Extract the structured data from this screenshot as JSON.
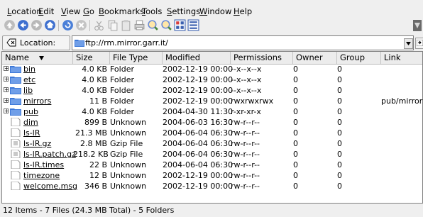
{
  "menu": [
    {
      "label": "Location",
      "u": "L",
      "rest": "ocation"
    },
    {
      "label": "Edit",
      "u": "E",
      "rest": "dit"
    },
    {
      "label": "View",
      "u": "V",
      "rest": "iew"
    },
    {
      "label": "Go",
      "u": "G",
      "rest": "o"
    },
    {
      "label": "Bookmarks",
      "u": "B",
      "rest": "ookmarks"
    },
    {
      "label": "Tools",
      "u": "T",
      "rest": "ools"
    },
    {
      "label": "Settings",
      "u": "S",
      "rest": "ettings"
    },
    {
      "label": "Window",
      "u": "W",
      "rest": "indow"
    },
    {
      "label": "Help",
      "u": "H",
      "rest": "elp"
    }
  ],
  "location": {
    "button_label": "Location:",
    "url": "ftp://rm.mirror.garr.it/"
  },
  "columns": [
    "Name",
    "Size",
    "File Type",
    "Modified",
    "Permissions",
    "Owner",
    "Group",
    "Link"
  ],
  "rows": [
    {
      "name": "bin",
      "size": "4.0 KB",
      "type": "Folder",
      "modified": "2002-12-19 00:00",
      "perm": "--x--x--x",
      "owner": "0",
      "group": "0",
      "link": "",
      "kind": "folder"
    },
    {
      "name": "etc",
      "size": "4.0 KB",
      "type": "Folder",
      "modified": "2002-12-19 00:00",
      "perm": "--x--x--x",
      "owner": "0",
      "group": "0",
      "link": "",
      "kind": "folder"
    },
    {
      "name": "lib",
      "size": "4.0 KB",
      "type": "Folder",
      "modified": "2002-12-19 00:00",
      "perm": "--x--x--x",
      "owner": "0",
      "group": "0",
      "link": "",
      "kind": "folder"
    },
    {
      "name": "mirrors",
      "size": "11 B",
      "type": "Folder",
      "modified": "2002-12-19 00:00",
      "perm": "rwxrwxrwx",
      "owner": "0",
      "group": "0",
      "link": "pub/mirrors",
      "kind": "folder"
    },
    {
      "name": "pub",
      "size": "4.0 KB",
      "type": "Folder",
      "modified": "2004-04-30 11:30",
      "perm": "r-xr-xr-x",
      "owner": "0",
      "group": "0",
      "link": "",
      "kind": "folder"
    },
    {
      "name": "dim",
      "size": "899 B",
      "type": "Unknown",
      "modified": "2004-06-03 16:30",
      "perm": "rw-r--r--",
      "owner": "0",
      "group": "0",
      "link": "",
      "kind": "file"
    },
    {
      "name": "ls-lR",
      "size": "21.3 MB",
      "type": "Unknown",
      "modified": "2004-06-04 06:30",
      "perm": "rw-r--r--",
      "owner": "0",
      "group": "0",
      "link": "",
      "kind": "file"
    },
    {
      "name": "ls-lR.gz",
      "size": "2.8 MB",
      "type": "Gzip File",
      "modified": "2004-06-04 06:30",
      "perm": "rw-r--r--",
      "owner": "0",
      "group": "0",
      "link": "",
      "kind": "gzip"
    },
    {
      "name": "ls-lR.patch.gz",
      "size": "218.2 KB",
      "type": "Gzip File",
      "modified": "2004-06-04 06:30",
      "perm": "rw-r--r--",
      "owner": "0",
      "group": "0",
      "link": "",
      "kind": "gzip"
    },
    {
      "name": "ls-lR.times",
      "size": "22 B",
      "type": "Unknown",
      "modified": "2004-06-04 06:30",
      "perm": "rw-r--r--",
      "owner": "0",
      "group": "0",
      "link": "",
      "kind": "file"
    },
    {
      "name": "timezone",
      "size": "12 B",
      "type": "Unknown",
      "modified": "2002-12-19 00:00",
      "perm": "rw-r--r--",
      "owner": "0",
      "group": "0",
      "link": "",
      "kind": "file"
    },
    {
      "name": "welcome.msg",
      "size": "346 B",
      "type": "Unknown",
      "modified": "2002-12-19 00:00",
      "perm": "rw-r--r--",
      "owner": "0",
      "group": "0",
      "link": "",
      "kind": "file"
    }
  ],
  "status_text": "12 Items - 7 Files (24.3 MB Total) - 5 Folders",
  "colors": {
    "accent": "#2f6fd6",
    "folder": "#3c78d8",
    "window_bg": "#efefef"
  }
}
